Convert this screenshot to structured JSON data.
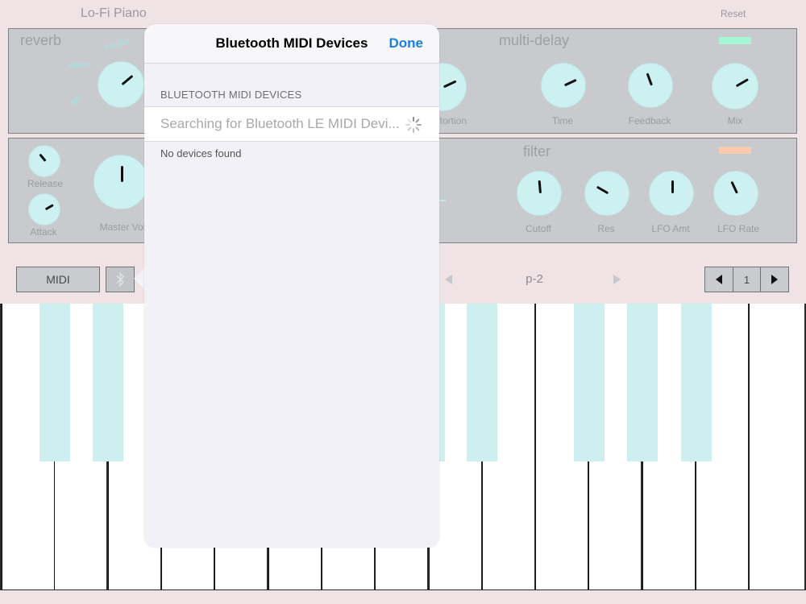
{
  "header": {
    "app_title": "Lo-Fi Piano",
    "reset_label": "Reset"
  },
  "panels": {
    "reverb": {
      "title": "reverb",
      "options": [
        "studio",
        "room",
        "off"
      ]
    },
    "multi_delay": {
      "title": "multi-delay",
      "knobs": [
        {
          "label": "Distortion",
          "visible_label": "tortion",
          "angle": 245
        },
        {
          "label": "Time",
          "angle": 245
        },
        {
          "label": "Feedback",
          "angle": 160
        },
        {
          "label": "Mix",
          "angle": 240
        }
      ],
      "led_color": "#a6f5d4"
    },
    "envelope": {
      "knobs": [
        {
          "label": "Release",
          "angle": 140
        },
        {
          "label": "Attack",
          "angle": 240
        },
        {
          "label": "Master Vol",
          "angle": 180
        }
      ]
    },
    "filter": {
      "title": "filter",
      "knobs": [
        {
          "label": "Cutoff",
          "angle": 175
        },
        {
          "label": "Res",
          "angle": 120
        },
        {
          "label": "LFO Amt",
          "angle": 180
        },
        {
          "label": "LFO Rate",
          "angle": 155
        }
      ],
      "led_color": "#fbcbb0"
    }
  },
  "controls": {
    "midi_label": "MIDI",
    "bluetooth_icon": "bluetooth-icon",
    "preset_name": "p-2",
    "octave_value": "1"
  },
  "popover": {
    "title": "Bluetooth MIDI Devices",
    "done_label": "Done",
    "section_header": "BLUETOOTH MIDI DEVICES",
    "searching_text": "Searching for Bluetooth LE MIDI Devi...",
    "empty_text": "No devices found"
  },
  "keyboard": {
    "accent_color": "#cdeff0"
  }
}
